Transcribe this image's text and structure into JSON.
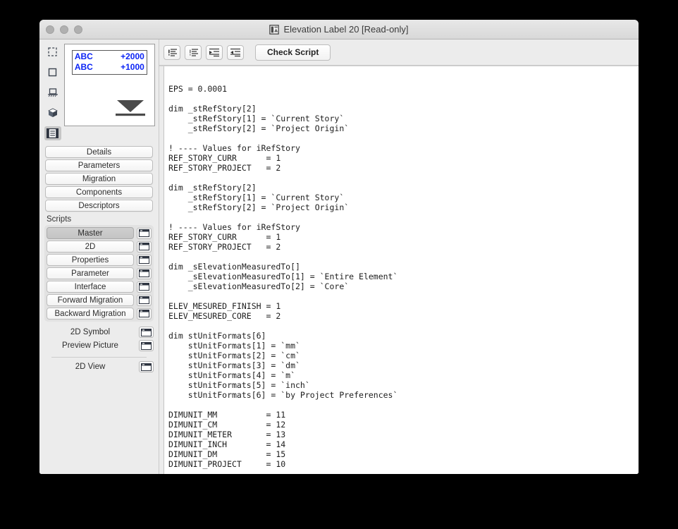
{
  "window": {
    "title": "Elevation Label 20 [Read-only]",
    "title_icon": "library-object-icon",
    "controls": [
      "close-button",
      "minimize-button",
      "zoom-button"
    ]
  },
  "left_panel": {
    "rail_icons": [
      "dashed-square-icon",
      "solid-square-icon",
      "section-hatch-icon",
      "cube-3d-icon",
      "script-list-icon"
    ],
    "rail_active_index": 4,
    "preview": {
      "rows": [
        {
          "text": "ABC",
          "value": "+2000"
        },
        {
          "text": "ABC",
          "value": "+1000"
        }
      ],
      "marker": "elevation-triangle-marker",
      "text_color": "#0b24f5"
    },
    "nav_buttons": [
      "Details",
      "Parameters",
      "Migration",
      "Components",
      "Descriptors"
    ],
    "scripts_label": "Scripts",
    "scripts": [
      {
        "label": "Master",
        "selected": true
      },
      {
        "label": "2D",
        "selected": false
      },
      {
        "label": "Properties",
        "selected": false
      },
      {
        "label": "Parameter",
        "selected": false
      },
      {
        "label": "Interface",
        "selected": false
      },
      {
        "label": "Forward Migration",
        "selected": false
      },
      {
        "label": "Backward Migration",
        "selected": false
      }
    ],
    "extra_rows": [
      "2D Symbol",
      "Preview Picture"
    ],
    "view_row": "2D View"
  },
  "toolbar": {
    "buttons": [
      "comment-lines-icon",
      "uncomment-lines-icon",
      "increase-indent-icon",
      "decrease-indent-icon"
    ],
    "check_script_label": "Check Script"
  },
  "editor": {
    "code": "EPS = 0.0001\n\ndim _stRefStory[2]\n    _stRefStory[1] = `Current Story`\n    _stRefStory[2] = `Project Origin`\n\n! ---- Values for iRefStory\nREF_STORY_CURR      = 1\nREF_STORY_PROJECT   = 2\n\ndim _stRefStory[2]\n    _stRefStory[1] = `Current Story`\n    _stRefStory[2] = `Project Origin`\n\n! ---- Values for iRefStory\nREF_STORY_CURR      = 1\nREF_STORY_PROJECT   = 2\n\ndim _sElevationMeasuredTo[]\n    _sElevationMeasuredTo[1] = `Entire Element`\n    _sElevationMeasuredTo[2] = `Core`\n\nELEV_MESURED_FINISH = 1\nELEV_MESURED_CORE   = 2\n\ndim stUnitFormats[6]\n    stUnitFormats[1] = `mm`\n    stUnitFormats[2] = `cm`\n    stUnitFormats[3] = `dm`\n    stUnitFormats[4] = `m`\n    stUnitFormats[5] = `inch`\n    stUnitFormats[6] = `by Project Preferences`\n\nDIMUNIT_MM          = 11\nDIMUNIT_CM          = 12\nDIMUNIT_METER       = 13\nDIMUNIT_INCH        = 14\nDIMUNIT_DM          = 15\nDIMUNIT_PROJECT     = 10"
  }
}
